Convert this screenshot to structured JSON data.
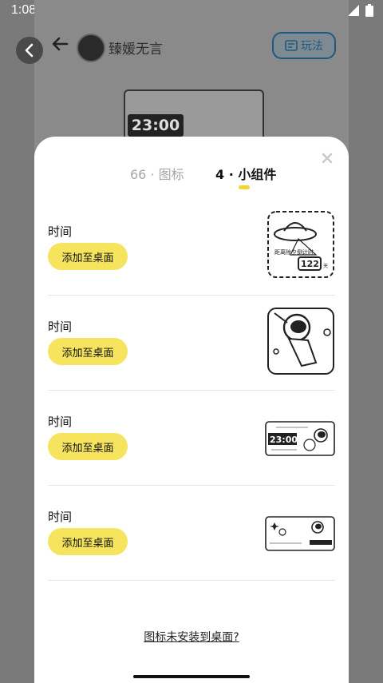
{
  "status_bar": {
    "time": "1:08"
  },
  "background_page": {
    "user_name": "臻媛无言",
    "play_label": "玩法",
    "clock_text": "23:00"
  },
  "tabs": [
    {
      "label": "66 · 图标",
      "active": false
    },
    {
      "label": "4 · 小组件",
      "active": true
    }
  ],
  "widgets": [
    {
      "title": "时间",
      "button": "添加至桌面",
      "preview": "ufo-countdown",
      "preview_text": [
        "距离除夕倒计时",
        "122",
        "天"
      ]
    },
    {
      "title": "时间",
      "button": "添加至桌面",
      "preview": "astronaut-square"
    },
    {
      "title": "时间",
      "button": "添加至桌面",
      "preview": "astronaut-clock-wide",
      "preview_text": [
        "23:00"
      ]
    },
    {
      "title": "时间",
      "button": "添加至桌面",
      "preview": "astronaut-stars-wide"
    }
  ],
  "help_link": "图标未安装到桌面?",
  "colors": {
    "accent": "#f6e35e",
    "indicator": "#f2d631",
    "inactive_tab": "#a6a6a6"
  }
}
